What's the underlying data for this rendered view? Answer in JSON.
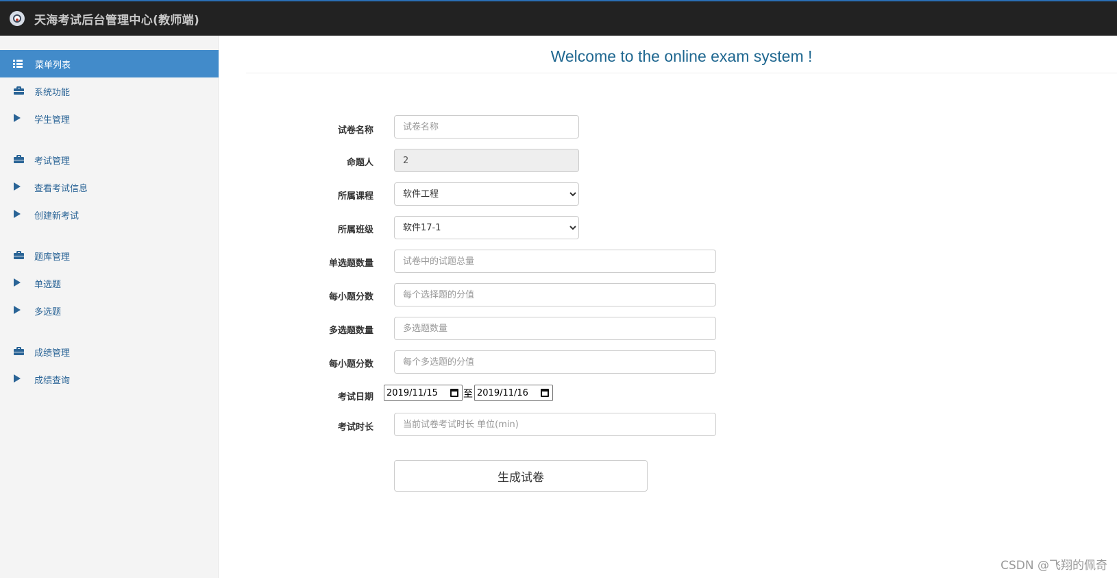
{
  "header": {
    "logo": "owl-logo-icon",
    "title": "天海考试后台管理中心(教师端)"
  },
  "sidebar": {
    "menu_title": "菜单列表",
    "groups": [
      {
        "label": "系统功能",
        "icon": "briefcase-icon",
        "items": [
          {
            "label": "学生管理",
            "icon": "play-icon"
          }
        ]
      },
      {
        "label": "考试管理",
        "icon": "briefcase-icon",
        "items": [
          {
            "label": "查看考试信息",
            "icon": "play-icon"
          },
          {
            "label": "创建新考试",
            "icon": "play-icon"
          }
        ]
      },
      {
        "label": "题库管理",
        "icon": "briefcase-icon",
        "items": [
          {
            "label": "单选题",
            "icon": "play-icon"
          },
          {
            "label": "多选题",
            "icon": "play-icon"
          }
        ]
      },
      {
        "label": "成绩管理",
        "icon": "briefcase-icon",
        "items": [
          {
            "label": "成绩查询",
            "icon": "play-icon"
          }
        ]
      }
    ]
  },
  "main": {
    "welcome": "Welcome to the online exam system !",
    "form": {
      "paper_name": {
        "label": "试卷名称",
        "placeholder": "试卷名称",
        "value": ""
      },
      "author": {
        "label": "命题人",
        "value": "2"
      },
      "course": {
        "label": "所属课程",
        "selected": "软件工程"
      },
      "class": {
        "label": "所属班级",
        "selected": "软件17-1"
      },
      "single_count": {
        "label": "单选题数量",
        "placeholder": "试卷中的试题总量"
      },
      "single_score": {
        "label": "每小题分数",
        "placeholder": "每个选择题的分值"
      },
      "multi_count": {
        "label": "多选题数量",
        "placeholder": "多选题数量"
      },
      "multi_score": {
        "label": "每小题分数",
        "placeholder": "每个多选题的分值"
      },
      "exam_date": {
        "label": "考试日期",
        "start": "2019/11/15",
        "separator": "至",
        "end": "2019/11/16"
      },
      "duration": {
        "label": "考试时长",
        "placeholder": "当前试卷考试时长 单位(min)"
      },
      "submit_label": "生成试卷"
    }
  },
  "watermark": "CSDN @飞翔的佩奇",
  "colors": {
    "topbar": "#222222",
    "accent": "#428bca",
    "link": "#2a6496",
    "welcome": "#1f6790"
  }
}
